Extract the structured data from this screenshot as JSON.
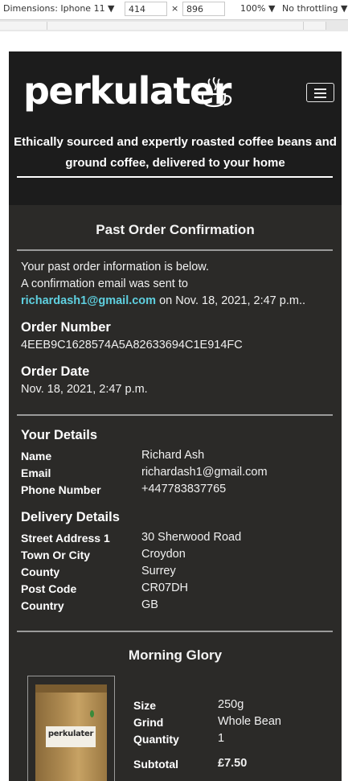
{
  "devtools": {
    "dimensions_label": "Dimensions: Iphone 11 ▼",
    "width": "414",
    "times": "×",
    "height": "896",
    "zoom": "100% ▼",
    "throttle": "No throttling ▼"
  },
  "header": {
    "logo": "perkulater",
    "tagline_line1": "Ethically sourced and expertly roasted coffee beans and",
    "tagline_line2": "ground coffee, delivered to your home"
  },
  "confirmation": {
    "title": "Past Order Confirmation",
    "intro_line1": "Your past order information is below.",
    "intro_line2": "A confirmation email was sent to",
    "email": "richardash1@gmail.com",
    "sent_on": "on Nov. 18, 2021, 2:47 p.m..",
    "order_number_heading": "Order Number",
    "order_number": "4EEB9C1628574A5A82633694C1E914FC",
    "order_date_heading": "Order Date",
    "order_date": "Nov. 18, 2021, 2:47 p.m."
  },
  "your_details": {
    "heading": "Your Details",
    "rows": [
      {
        "label": "Name",
        "value": "Richard Ash"
      },
      {
        "label": "Email",
        "value": "richardash1@gmail.com"
      },
      {
        "label": "Phone Number",
        "value": "+447783837765"
      }
    ]
  },
  "delivery_details": {
    "heading": "Delivery Details",
    "rows": [
      {
        "label": "Street Address 1",
        "value": "30 Sherwood Road"
      },
      {
        "label": "Town Or City",
        "value": "Croydon"
      },
      {
        "label": "County",
        "value": "Surrey"
      },
      {
        "label": "Post Code",
        "value": "CR07DH"
      },
      {
        "label": "Country",
        "value": "GB"
      }
    ]
  },
  "product": {
    "name": "Morning Glory",
    "bag_label": "perkulater",
    "rows": [
      {
        "label": "Size",
        "value": "250g"
      },
      {
        "label": "Grind",
        "value": "Whole Bean"
      },
      {
        "label": "Quantity",
        "value": "1"
      }
    ],
    "subtotal_label": "Subtotal",
    "subtotal_value": "£7.50"
  },
  "colors": {
    "page_bg": "#2b2a28",
    "header_bg": "#1c1c1c",
    "link": "#5fd0e0"
  }
}
